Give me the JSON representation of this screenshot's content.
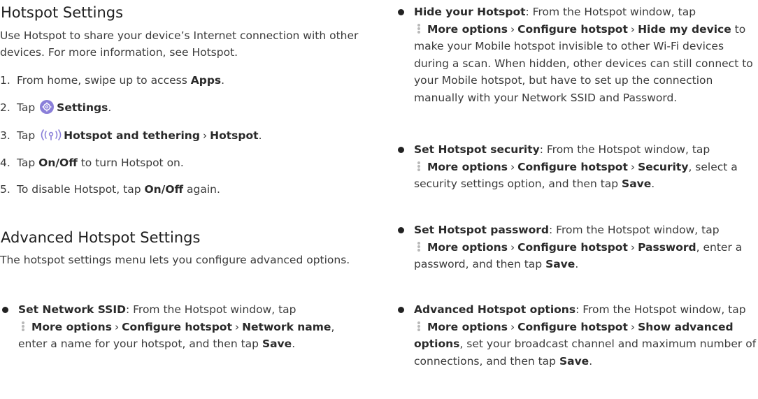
{
  "left": {
    "title": "Hotspot Settings",
    "intro": "Use Hotspot to share your device’s Internet connection with other devices. For more information, see Hotspot.",
    "steps": [
      {
        "num": "1.",
        "a": "From home, swipe up to access ",
        "b": "Apps",
        "c": "."
      },
      {
        "num": "2.",
        "a": "Tap ",
        "b": "Settings",
        "c": "."
      },
      {
        "num": "3.",
        "a": "Tap ",
        "b1": "Hotspot and tethering",
        "sep": "›",
        "b2": "Hotspot",
        "c": "."
      },
      {
        "num": "4.",
        "a": "Tap ",
        "b": "On/Off",
        "c": " to turn Hotspot on."
      },
      {
        "num": "5.",
        "a": "To disable Hotspot, tap ",
        "b": "On/Off",
        "c": " again."
      }
    ],
    "adv_title": "Advanced Hotspot Settings",
    "adv_intro": "The hotspot settings menu lets you configure advanced options.",
    "bullet1": {
      "label": "Set Network SSID",
      "t1": ": From the Hotspot window, tap",
      "more": "More options",
      "configure": "Configure hotspot",
      "target": "Network name",
      "t2": ", enter a name for your hotspot, and then tap ",
      "save": "Save",
      "end": "."
    }
  },
  "right": {
    "b1": {
      "label": "Hide your Hotspot",
      "t1": ": From the Hotspot window, tap",
      "more": "More options",
      "configure": "Configure hotspot",
      "target": "Hide my device",
      "t2": " to make your Mobile hotspot invisible to other Wi-Fi devices during a scan. When hidden, other devices can still connect to your Mobile hotspot, but have to set up the connection manually with your Network SSID and Password."
    },
    "b2": {
      "label": "Set Hotspot security",
      "t1": ": From the Hotspot window, tap",
      "more": "More options",
      "configure": "Configure hotspot",
      "target": "Security",
      "t2": ", select a security settings option, and then tap ",
      "save": "Save",
      "end": "."
    },
    "b3": {
      "label": "Set Hotspot password",
      "t1": ": From the Hotspot window, tap",
      "more": "More options",
      "configure": "Configure hotspot",
      "target": "Password",
      "t2": ", enter a password, and then tap ",
      "save": "Save",
      "end": "."
    },
    "b4": {
      "label": "Advanced Hotspot options",
      "t1": ": From the Hotspot window, tap",
      "more": "More options",
      "configure": "Configure hotspot",
      "target": "Show advanced options",
      "t2": ", set your broadcast channel and maximum number of connections, and then tap ",
      "save": "Save",
      "end": "."
    },
    "sep": "›"
  },
  "colors": {
    "settings_icon": "#8a7fd9",
    "hotspot_icon": "#8a7fd9",
    "more_dots": "#b9b9b9"
  }
}
